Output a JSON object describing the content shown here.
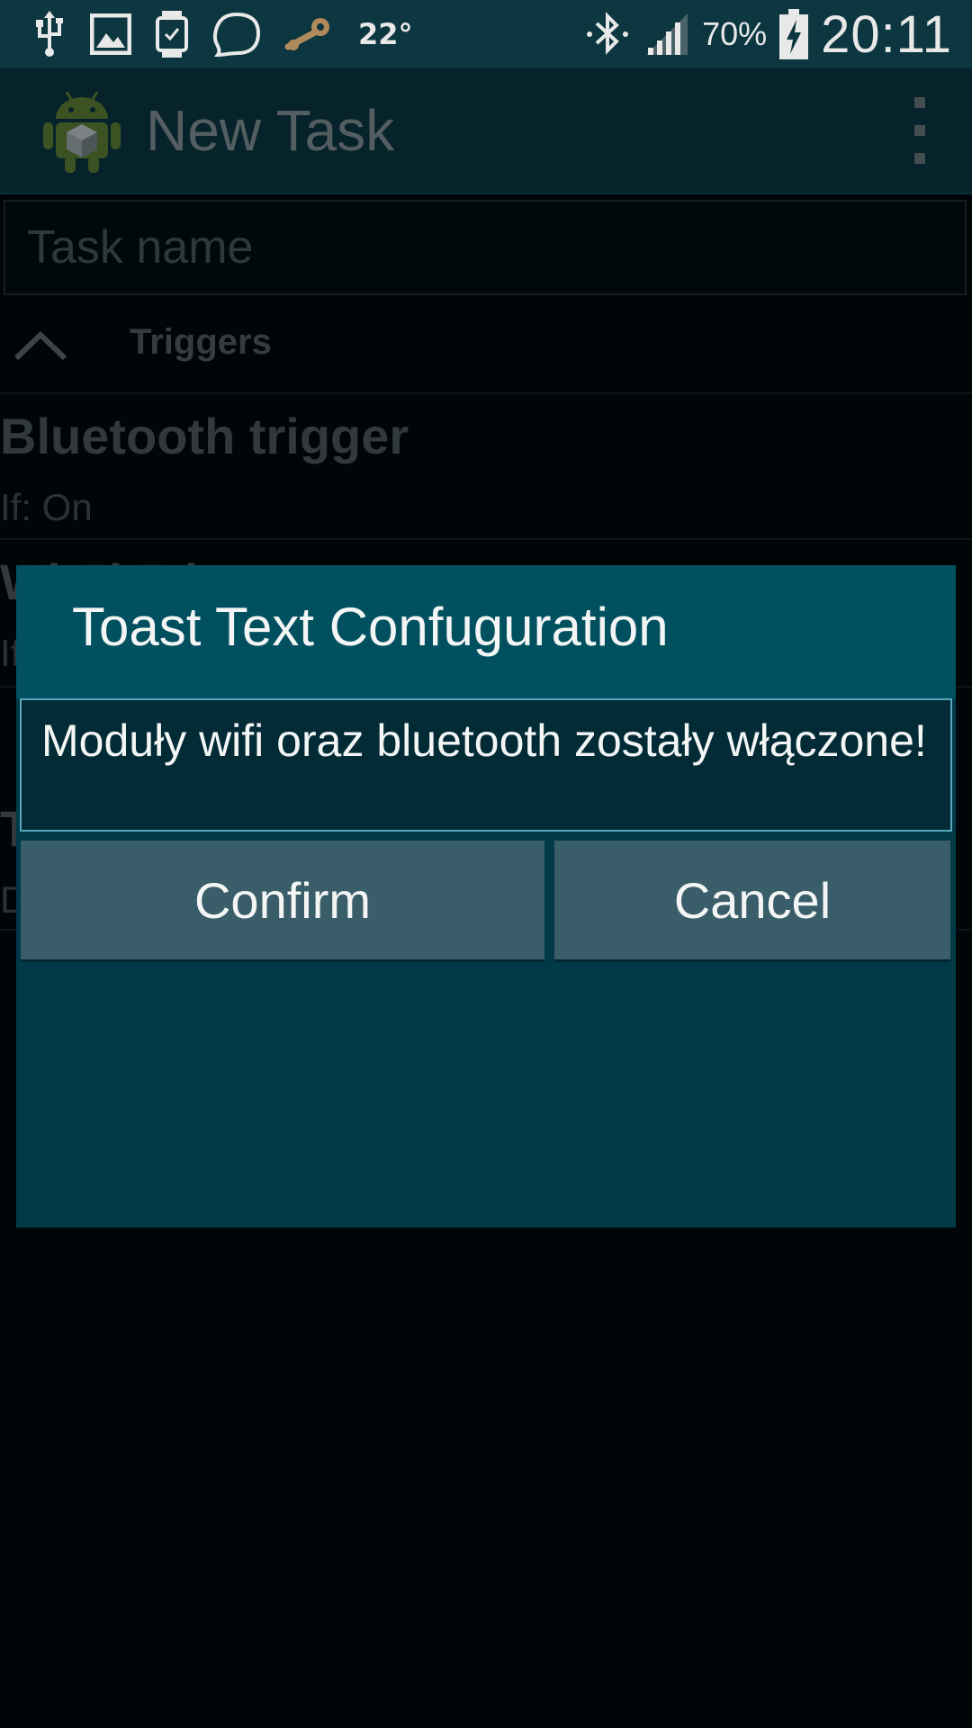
{
  "status_bar": {
    "icons_left": [
      "usb-icon",
      "image-icon",
      "smartwatch-icon",
      "chat-bubble-icon",
      "steam-icon"
    ],
    "temperature": "22°",
    "icons_right": [
      "bluetooth-icon",
      "signal-icon"
    ],
    "battery_percent": "70%",
    "battery_icon": "battery-charging-icon",
    "time": "20:11"
  },
  "action_bar": {
    "title": "New Task",
    "app_icon": "android-box-icon",
    "overflow_icon": "overflow-menu-icon"
  },
  "task_name": {
    "placeholder": "Task name",
    "value": ""
  },
  "triggers_section": {
    "title": "Triggers",
    "collapse_icon": "chevron-up-icon",
    "items": [
      {
        "title": "Bluetooth trigger",
        "subtitle": "If: On"
      },
      {
        "title": "Wi-Fi Trigger",
        "subtitle": "If: On"
      }
    ]
  },
  "background_partial": [
    {
      "title": "T",
      "subtitle": "D"
    }
  ],
  "dialog": {
    "title": "Toast Text Confuguration",
    "input_value": "Moduły wifi oraz bluetooth zostały włączone!",
    "confirm_label": "Confirm",
    "cancel_label": "Cancel"
  },
  "colors": {
    "bar": "#0c3640",
    "dialog_title_bg": "#01505f",
    "dialog_body_bg": "#003a48",
    "input_border": "#5aa6bd",
    "button_bg": "#3a5e69"
  }
}
